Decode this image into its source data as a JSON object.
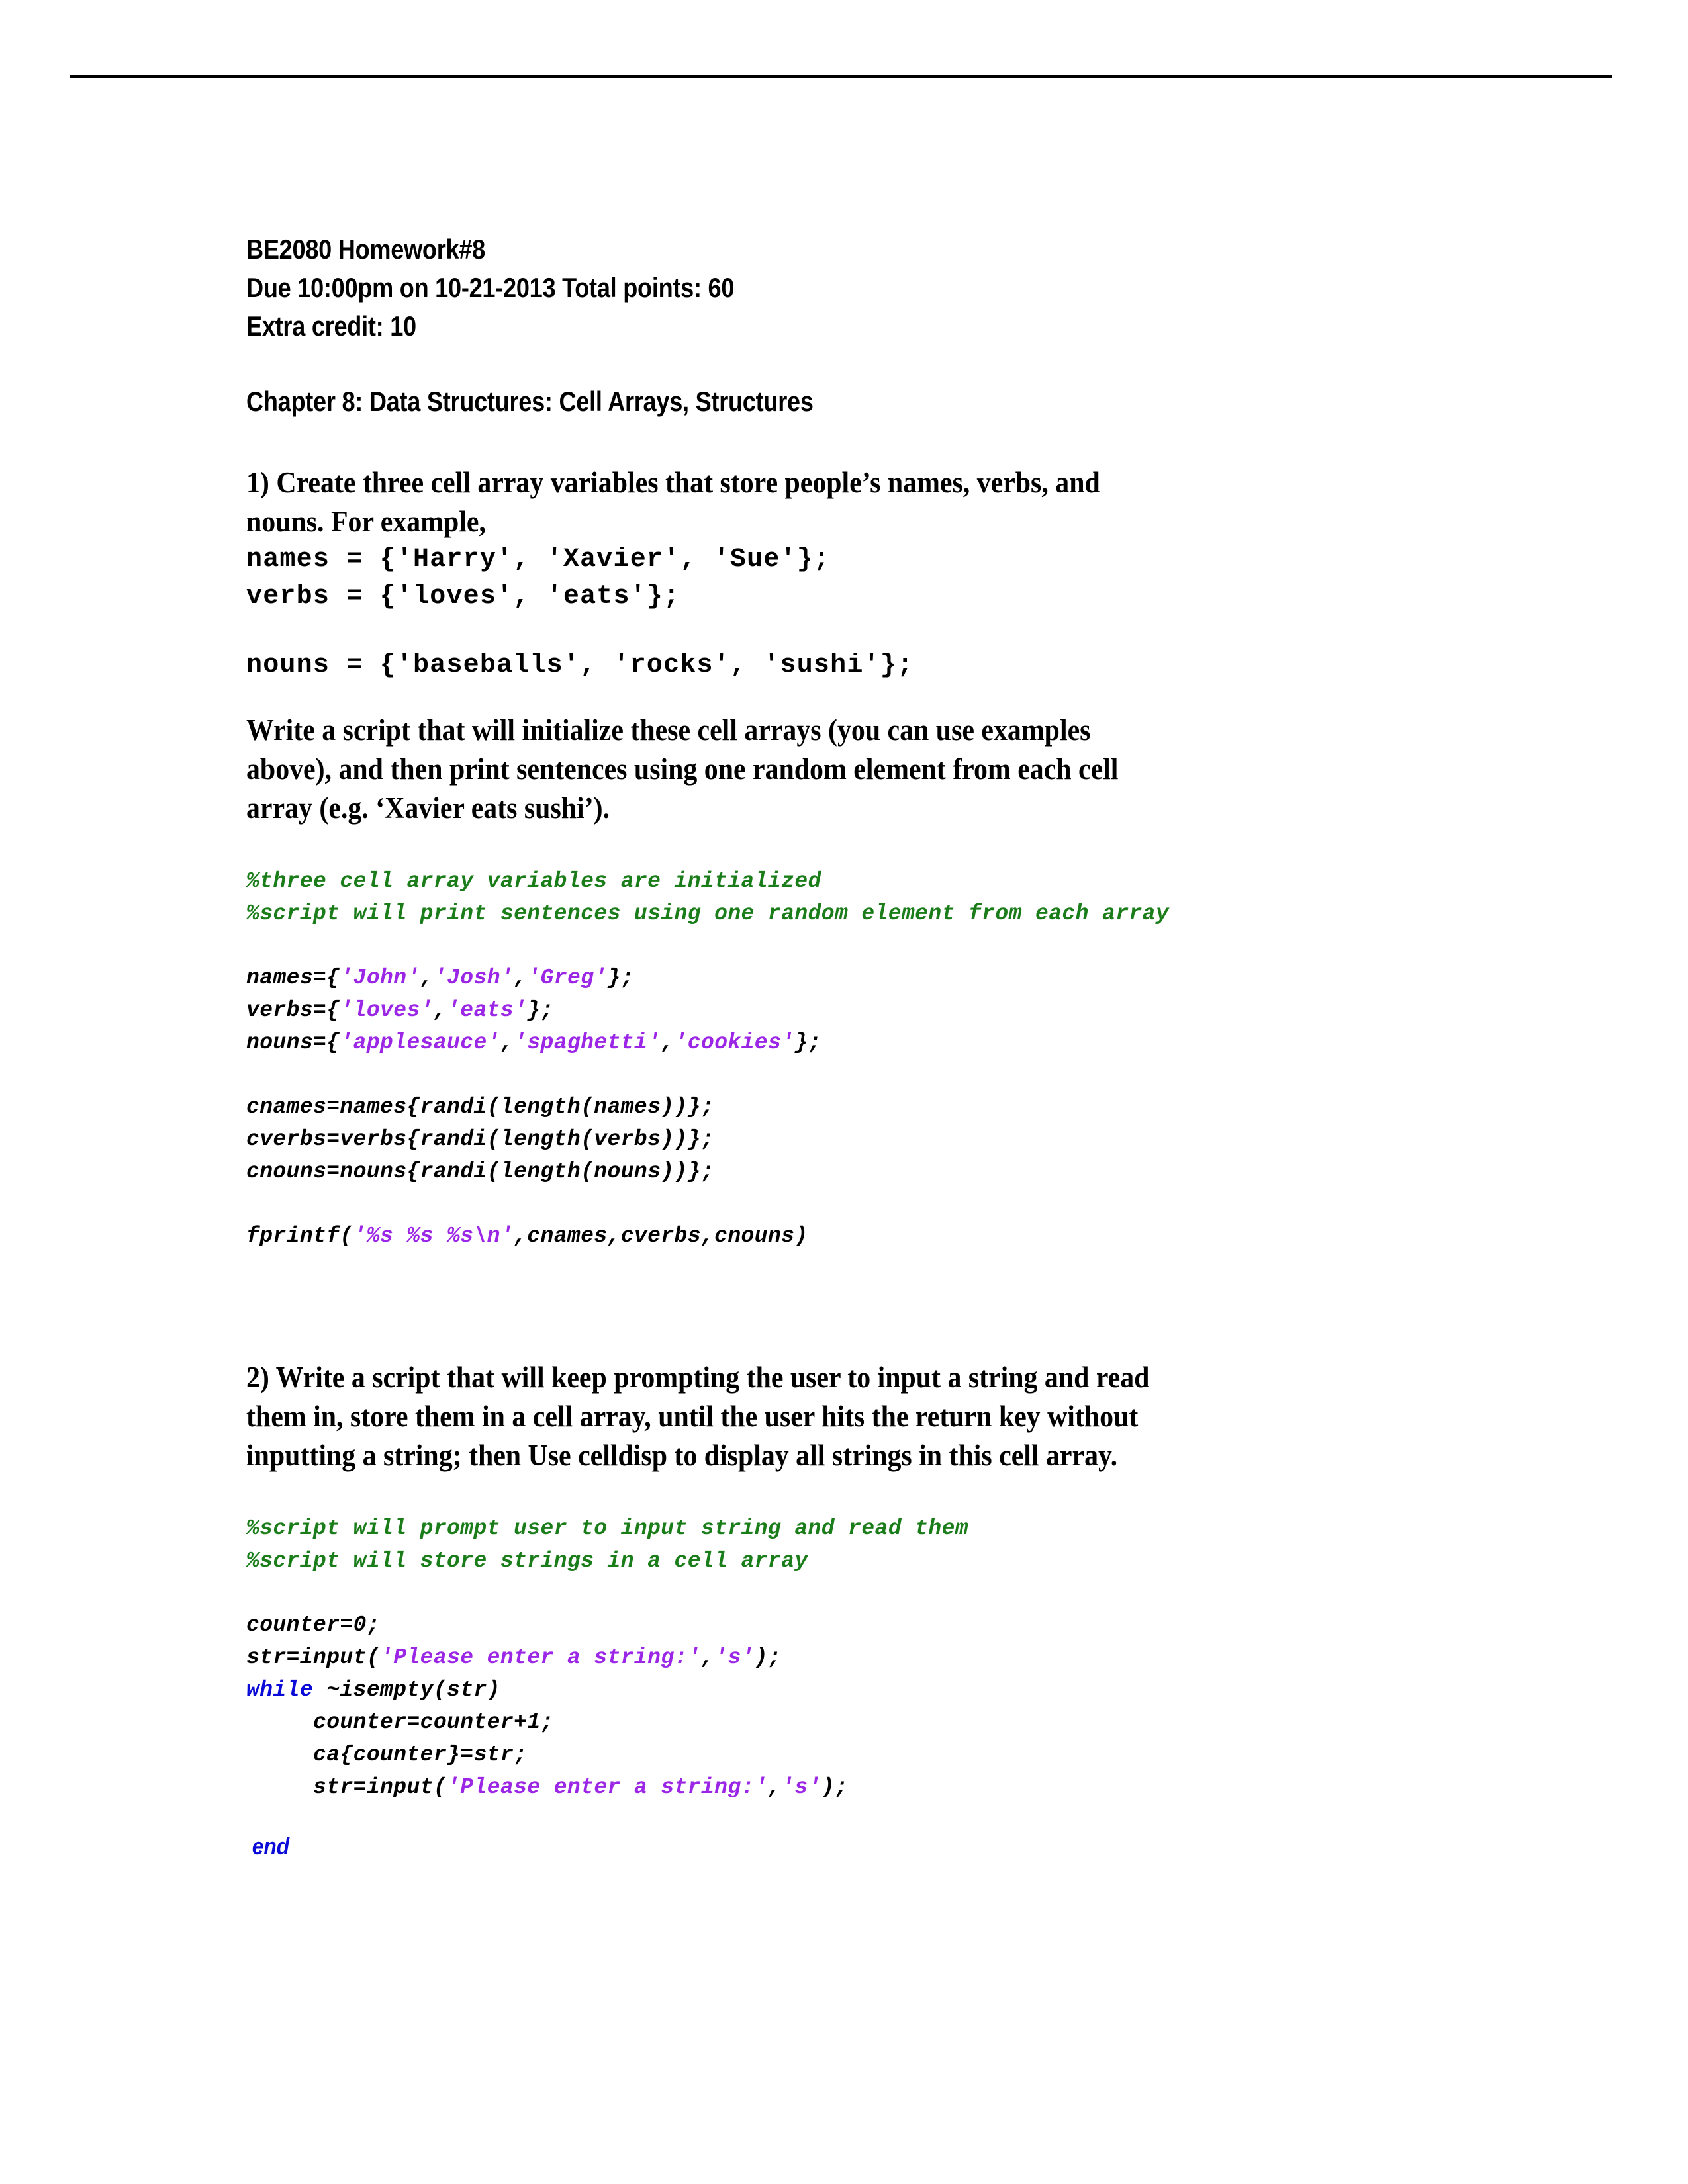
{
  "document": {
    "header": {
      "lines": [
        "BE2080 Homework#8",
        "Due 10:00pm on 10-21-2013 Total points: 60",
        "Extra credit: 10"
      ],
      "chapter": "Chapter 8: Data Structures: Cell Arrays, Structures"
    },
    "colors": {
      "text": "#000000",
      "comment_green": "#1a7d1a",
      "string_purple": "#9b26e6",
      "keyword_blue": "#0b0bd8",
      "rule": "#000000",
      "background": "#ffffff"
    },
    "questions": [
      {
        "number": "1)",
        "prompt_line_1": "1) Create three cell array variables that store people’s names, verbs, and",
        "prompt_line_2": "nouns. For example,",
        "example_code": [
          "names = {'Harry', 'Xavier', 'Sue'};",
          "verbs = {'loves', 'eats'};"
        ],
        "example_code_2": "nouns = {'baseballs', 'rocks', 'sushi'};",
        "prompt_tail": [
          "Write a script that will initialize these cell arrays (you can use examples",
          "above), and then print sentences using one random element from each cell",
          "array (e.g. ‘Xavier eats sushi’)."
        ],
        "answer_comments": [
          "%three cell array variables are initialized",
          "%script will print sentences using one random element from each array"
        ],
        "answer_decls": [
          {
            "lhs": "names={",
            "strings": [
              "'John'",
              "'Josh'",
              "'Greg'"
            ],
            "tail": "};"
          },
          {
            "lhs": "verbs={",
            "strings": [
              "'loves'",
              "'eats'"
            ],
            "tail": "};"
          },
          {
            "lhs": "nouns={",
            "strings": [
              "'applesauce'",
              "'spaghetti'",
              "'cookies'"
            ],
            "tail": "};"
          }
        ],
        "answer_body": [
          "cnames=names{randi(length(names))};",
          "cverbs=verbs{randi(length(verbs))};",
          "cnouns=nouns{randi(length(nouns))};"
        ],
        "answer_print": {
          "prefix": "fprintf(",
          "fmt": "'%s %s %s\\n'",
          "suffix": ",cnames,cverbs,cnouns)"
        }
      },
      {
        "number": "2)",
        "prompt_lines": [
          "2) Write a script that will keep prompting the user to input a string and read",
          "them in, store them in a cell array, until the user hits the return key without",
          "inputting a string; then Use celldisp to display all strings in this cell array."
        ],
        "answer_comments": [
          "%script will prompt user to input string and read them",
          "%script will store strings in a cell array"
        ],
        "answer_lines": [
          {
            "indent": "",
            "parts": [
              {
                "t": "counter=0;",
                "c": "plain"
              }
            ]
          },
          {
            "indent": "",
            "parts": [
              {
                "t": "str=input(",
                "c": "plain"
              },
              {
                "t": "'Please enter a string:'",
                "c": "str"
              },
              {
                "t": ",",
                "c": "plain"
              },
              {
                "t": "'s'",
                "c": "str"
              },
              {
                "t": ");",
                "c": "plain"
              }
            ]
          },
          {
            "indent": "",
            "parts": [
              {
                "t": "while",
                "c": "kw"
              },
              {
                "t": " ~isempty(str)",
                "c": "plain"
              }
            ]
          },
          {
            "indent": "     ",
            "parts": [
              {
                "t": "counter=counter+1;",
                "c": "plain"
              }
            ]
          },
          {
            "indent": "     ",
            "parts": [
              {
                "t": "ca{counter}=str;",
                "c": "plain"
              }
            ]
          },
          {
            "indent": "     ",
            "parts": [
              {
                "t": "str=input(",
                "c": "plain"
              },
              {
                "t": "'Please enter a string:'",
                "c": "str"
              },
              {
                "t": ",",
                "c": "plain"
              },
              {
                "t": "'s'",
                "c": "str"
              },
              {
                "t": ");",
                "c": "plain"
              }
            ]
          }
        ],
        "answer_end": " end"
      }
    ]
  }
}
